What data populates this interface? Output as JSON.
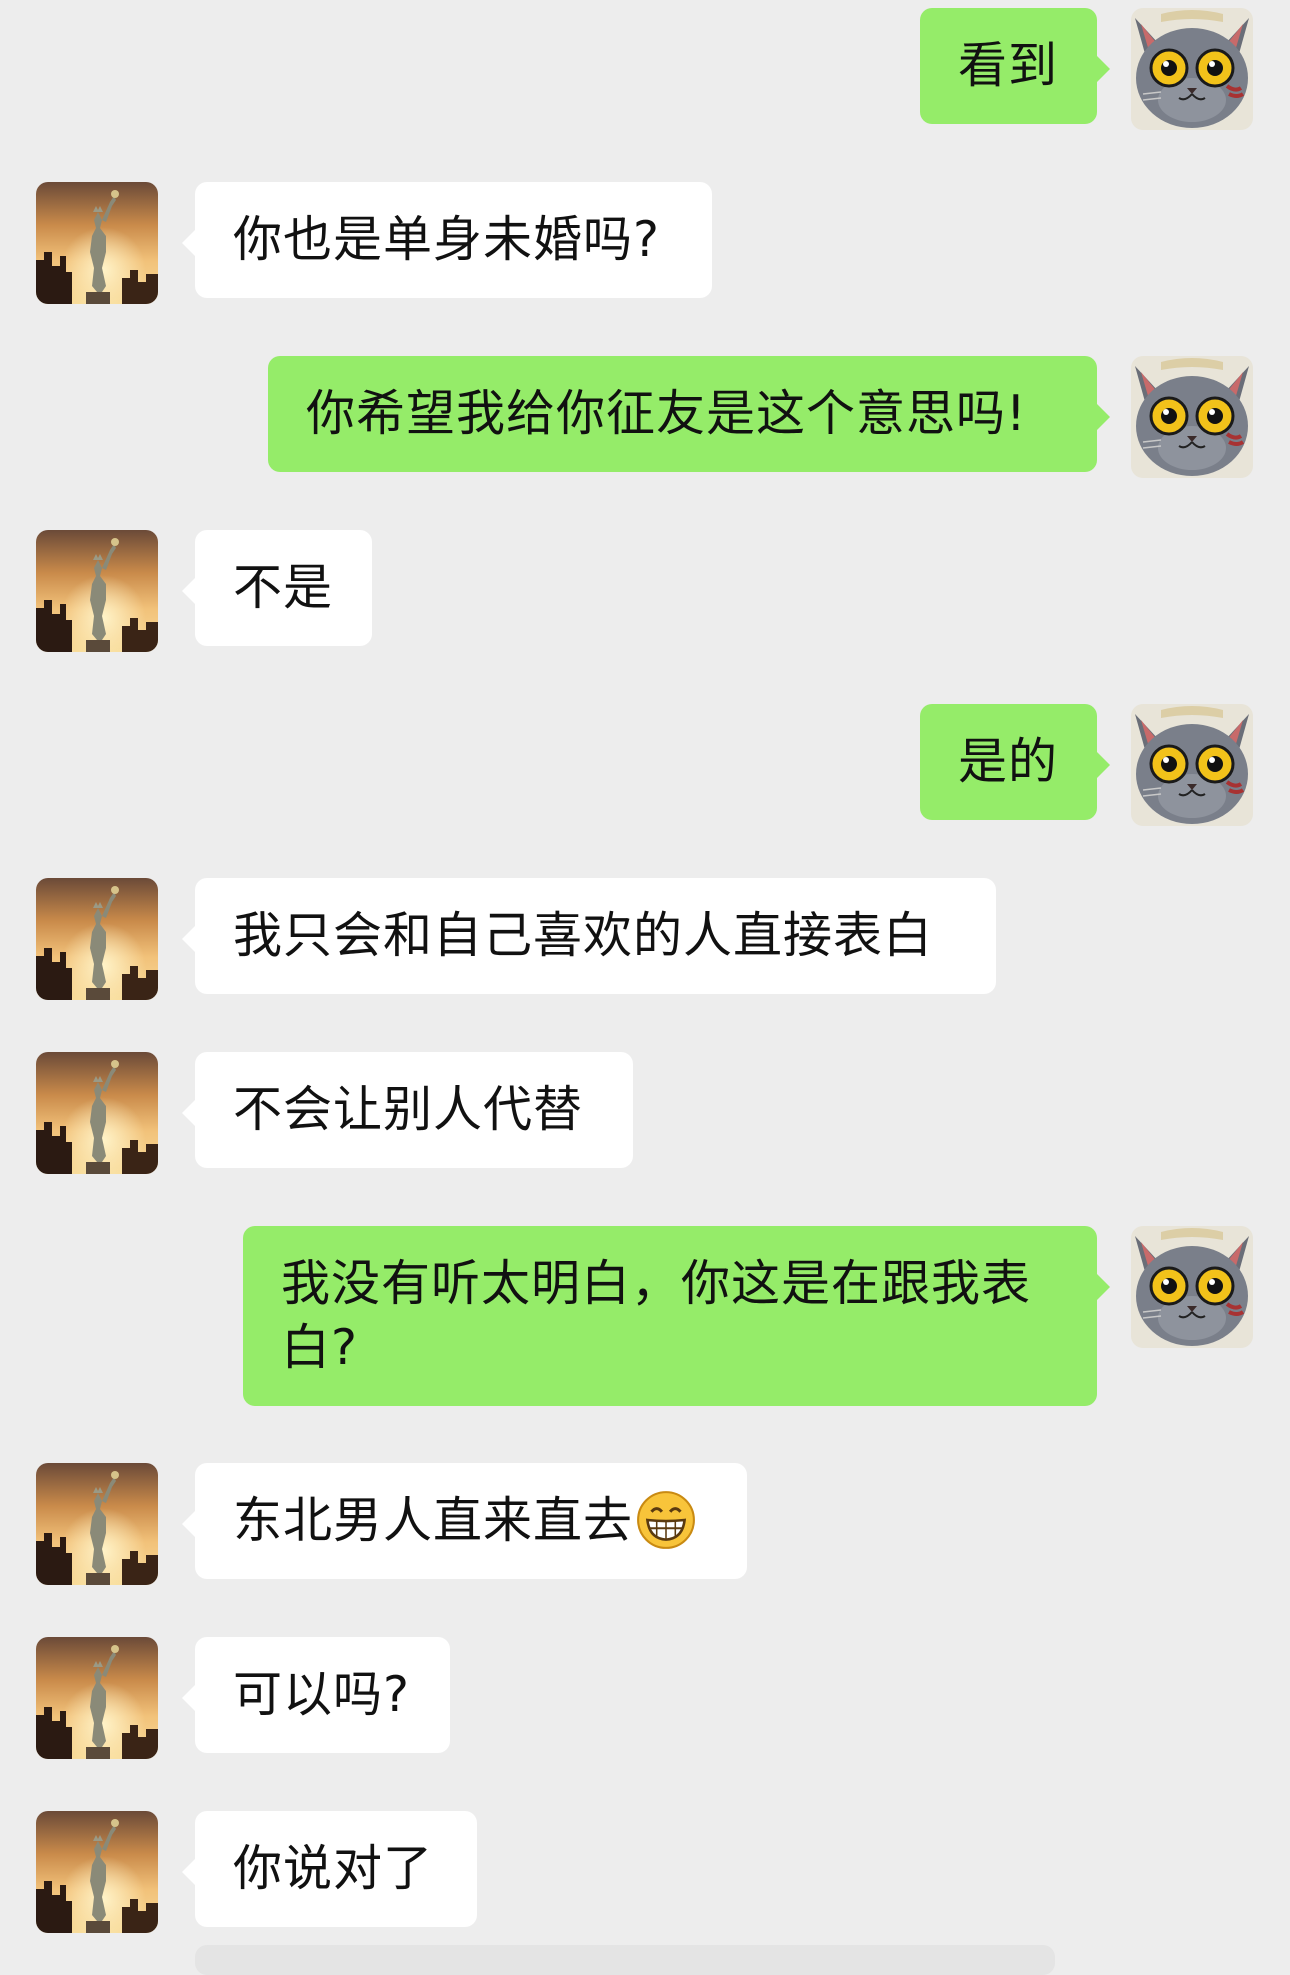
{
  "chat": {
    "messages": [
      {
        "side": "out",
        "text": "看到"
      },
      {
        "side": "in",
        "text": "你也是单身未婚吗?"
      },
      {
        "side": "out",
        "text": "你希望我给你征友是这个意思吗!"
      },
      {
        "side": "in",
        "text": "不是"
      },
      {
        "side": "out",
        "text": "是的"
      },
      {
        "side": "in",
        "text": "我只会和自己喜欢的人直接表白"
      },
      {
        "side": "in",
        "text": "不会让别人代替"
      },
      {
        "side": "out",
        "text": "我没有听太明白，你这是在跟我表白?"
      },
      {
        "side": "in",
        "text": "东北男人直来直去",
        "emoji": "grinning-face-emoji"
      },
      {
        "side": "in",
        "text": "可以吗?"
      },
      {
        "side": "in",
        "text": "你说对了"
      }
    ]
  },
  "avatars": {
    "contact": "statue-of-liberty-sunset-avatar",
    "self": "gray-cat-avatar"
  },
  "colors": {
    "background": "#ededed",
    "incoming_bubble": "#ffffff",
    "outgoing_bubble": "#95ec69",
    "text": "#111111"
  }
}
